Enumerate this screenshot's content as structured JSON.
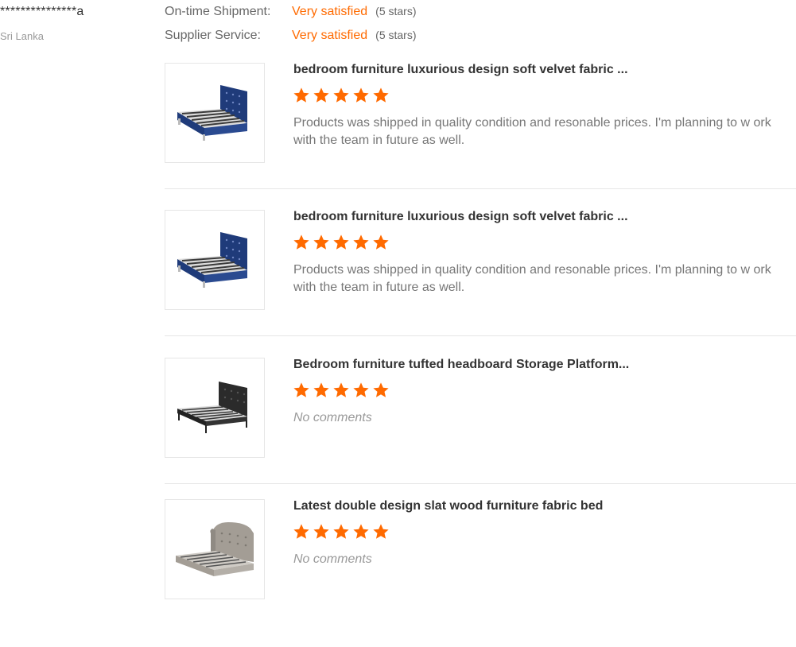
{
  "user": {
    "name": "***************a",
    "country": "Sri Lanka"
  },
  "ratings": [
    {
      "label": "On-time Shipment:",
      "value": "Very satisfied",
      "note": "(5 stars)"
    },
    {
      "label": "Supplier Service:",
      "value": "Very satisfied",
      "note": "(5 stars)"
    }
  ],
  "reviews": [
    {
      "title": "bedroom furniture luxurious design soft velvet fabric ...",
      "stars": 5,
      "comment": "Products was shipped in quality condition and resonable prices. I'm planning to w ork with the team in future as well.",
      "image_icon": "navy-velvet-bed-image"
    },
    {
      "title": "bedroom furniture luxurious design soft velvet fabric ...",
      "stars": 5,
      "comment": "Products was shipped in quality condition and resonable prices. I'm planning to w ork with the team in future as well.",
      "image_icon": "navy-velvet-bed-image"
    },
    {
      "title": "Bedroom furniture tufted headboard Storage Platform...",
      "stars": 5,
      "comment": "No comments",
      "image_icon": "black-tufted-bed-image"
    },
    {
      "title": "Latest double design slat wood furniture fabric bed",
      "stars": 5,
      "comment": "No comments",
      "image_icon": "grey-wingback-bed-image"
    }
  ],
  "colors": {
    "accent": "#ff6a00",
    "star": "#ff6a00"
  }
}
